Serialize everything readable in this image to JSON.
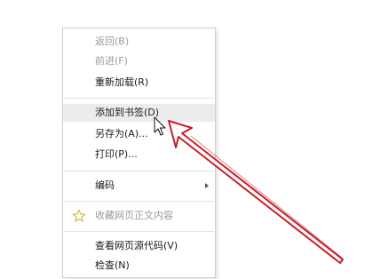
{
  "context_menu": {
    "items": [
      {
        "label": "返回(B)",
        "state": "disabled"
      },
      {
        "label": "前进(F)",
        "state": "disabled"
      },
      {
        "label": "重新加载(R)",
        "state": "enabled"
      },
      {
        "label": "添加到书签(D)",
        "state": "highlighted"
      },
      {
        "label": "另存为(A)...",
        "state": "enabled"
      },
      {
        "label": "打印(P)...",
        "state": "enabled"
      },
      {
        "label": "编码",
        "state": "enabled",
        "submenu": true
      },
      {
        "label": "收藏网页正文内容",
        "state": "disabled",
        "icon": "star-icon"
      },
      {
        "label": "查看网页源代码(V)",
        "state": "enabled"
      },
      {
        "label": "检查(N)",
        "state": "enabled"
      }
    ]
  },
  "colors": {
    "annotation_arrow": "#c8202a",
    "star_icon": "#d9b64a",
    "highlight_background": "#ececec",
    "disabled_text": "#9a9a9a"
  },
  "icons": {
    "cursor": "mouse-pointer-icon",
    "annotation": "red-arrow-annotation"
  }
}
